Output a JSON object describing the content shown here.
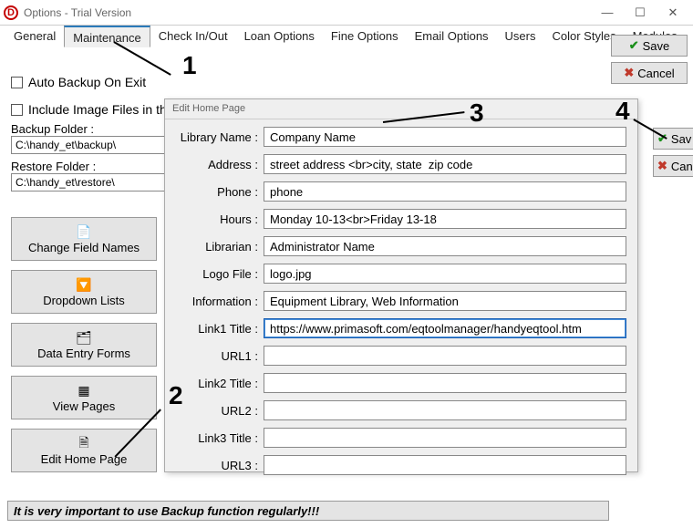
{
  "window": {
    "title": "Options - Trial Version"
  },
  "tabs": [
    "General",
    "Maintenance",
    "Check In/Out",
    "Loan Options",
    "Fine Options",
    "Email Options",
    "Users",
    "Color Styles",
    "Modules"
  ],
  "activeTab": "Maintenance",
  "maint": {
    "autoBackupLabel": "Auto Backup On Exit",
    "includeImageLabel": "Include Image Files in the",
    "backupFolderLabel": "Backup Folder :",
    "backupFolderValue": "C:\\handy_et\\backup\\",
    "restoreFolderLabel": "Restore Folder :",
    "restoreFolderValue": "C:\\handy_et\\restore\\"
  },
  "toolButtons": {
    "changeFieldNames": "Change Field Names",
    "dropdownLists": "Dropdown Lists",
    "dataEntryForms": "Data Entry Forms",
    "viewPages": "View Pages",
    "editHomePage": "Edit Home Page"
  },
  "actions": {
    "save": "Save",
    "cancel": "Cancel"
  },
  "dialog": {
    "title": "Edit Home Page",
    "fields": {
      "libraryName": {
        "label": "Library Name :",
        "value": "Company Name"
      },
      "address": {
        "label": "Address :",
        "value": "street address <br>city, state  zip code"
      },
      "phone": {
        "label": "Phone :",
        "value": "phone"
      },
      "hours": {
        "label": "Hours :",
        "value": "Monday 10-13<br>Friday 13-18"
      },
      "librarian": {
        "label": "Librarian :",
        "value": "Administrator Name"
      },
      "logoFile": {
        "label": "Logo File :",
        "value": "logo.jpg"
      },
      "information": {
        "label": "Information :",
        "value": "Equipment Library, Web Information"
      },
      "link1Title": {
        "label": "Link1 Title :",
        "value": "https://www.primasoft.com/eqtoolmanager/handyeqtool.htm"
      },
      "url1": {
        "label": "URL1 :",
        "value": ""
      },
      "link2Title": {
        "label": "Link2 Title :",
        "value": ""
      },
      "url2": {
        "label": "URL2 :",
        "value": ""
      },
      "link3Title": {
        "label": "Link3 Title :",
        "value": ""
      },
      "url3": {
        "label": "URL3 :",
        "value": ""
      }
    }
  },
  "footer": "It is very important to use Backup function regularly!!!",
  "annotations": {
    "a1": "1",
    "a2": "2",
    "a3": "3",
    "a4": "4"
  }
}
